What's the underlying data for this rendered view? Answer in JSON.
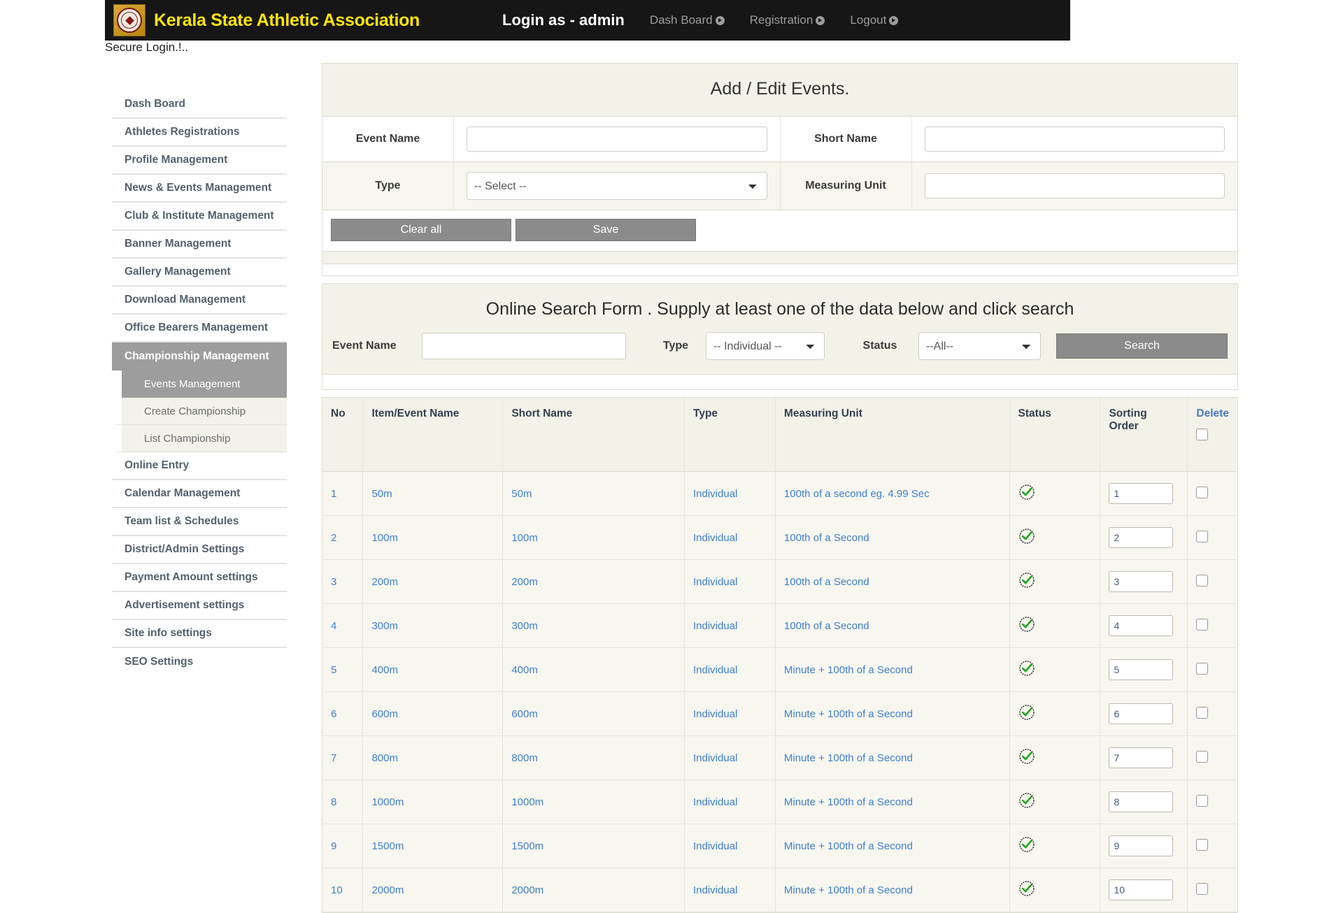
{
  "header": {
    "brand_title": "Kerala State Athletic Association",
    "logo_name": "ksaa-seal-logo",
    "login_as": "Login as - admin",
    "nav": [
      {
        "label": "Dash Board",
        "icon": "arrow-circle-icon"
      },
      {
        "label": "Registration",
        "icon": "arrow-circle-icon"
      },
      {
        "label": "Logout",
        "icon": "arrow-circle-icon"
      }
    ]
  },
  "secure_login_text": "Secure Login.!..",
  "sidebar": {
    "items": [
      {
        "label": "Dash Board",
        "active": false
      },
      {
        "label": "Athletes Registrations",
        "active": false
      },
      {
        "label": "Profile Management",
        "active": false
      },
      {
        "label": "News & Events Management",
        "active": false
      },
      {
        "label": "Club & Institute Management",
        "active": false
      },
      {
        "label": "Banner Management",
        "active": false
      },
      {
        "label": "Gallery Management",
        "active": false
      },
      {
        "label": "Download Management",
        "active": false
      },
      {
        "label": "Office Bearers Management",
        "active": false
      },
      {
        "label": "Championship Management",
        "active": true
      }
    ],
    "sub_items": [
      {
        "label": "Events Management",
        "active": true
      },
      {
        "label": "Create Championship",
        "active": false
      },
      {
        "label": "List Championship",
        "active": false
      }
    ],
    "items_after": [
      {
        "label": "Online Entry"
      },
      {
        "label": "Calendar Management"
      },
      {
        "label": "Team list & Schedules"
      },
      {
        "label": "District/Admin Settings"
      },
      {
        "label": "Payment Amount settings"
      },
      {
        "label": "Advertisement settings"
      },
      {
        "label": "Site info settings"
      },
      {
        "label": "SEO Settings"
      }
    ]
  },
  "add_edit_panel": {
    "title": "Add / Edit Events.",
    "fields": {
      "event_name_label": "Event Name",
      "event_name_value": "",
      "short_name_label": "Short Name",
      "short_name_value": "",
      "type_label": "Type",
      "type_value": "-- Select --",
      "measuring_unit_label": "Measuring Unit",
      "measuring_unit_value": ""
    },
    "buttons": {
      "clear_all": "Clear all",
      "save": "Save"
    }
  },
  "search_panel": {
    "title": "Online Search Form . Supply at least one of the data below and click search",
    "event_name_label": "Event Name",
    "event_name_value": "",
    "type_label": "Type",
    "type_value": "-- Individual --",
    "status_label": "Status",
    "status_value": "--All--",
    "search_button": "Search"
  },
  "table": {
    "headers": [
      "No",
      "Item/Event Name",
      "Short Name",
      "Type",
      "Measuring Unit",
      "Status",
      "Sorting Order",
      "Delete"
    ],
    "header_delete_checkbox": false,
    "rows": [
      {
        "no": "1",
        "item": "50m",
        "short": "50m",
        "type": "Individual",
        "unit": "100th of a second eg. 4.99 Sec",
        "status": "active",
        "sort": "1",
        "delete": false
      },
      {
        "no": "2",
        "item": "100m",
        "short": "100m",
        "type": "Individual",
        "unit": "100th of a Second",
        "status": "active",
        "sort": "2",
        "delete": false
      },
      {
        "no": "3",
        "item": "200m",
        "short": "200m",
        "type": "Individual",
        "unit": "100th of a Second",
        "status": "active",
        "sort": "3",
        "delete": false
      },
      {
        "no": "4",
        "item": "300m",
        "short": "300m",
        "type": "Individual",
        "unit": "100th of a Second",
        "status": "active",
        "sort": "4",
        "delete": false
      },
      {
        "no": "5",
        "item": "400m",
        "short": "400m",
        "type": "Individual",
        "unit": "Minute + 100th of a Second",
        "status": "active",
        "sort": "5",
        "delete": false
      },
      {
        "no": "6",
        "item": "600m",
        "short": "600m",
        "type": "Individual",
        "unit": "Minute + 100th of a Second",
        "status": "active",
        "sort": "6",
        "delete": false
      },
      {
        "no": "7",
        "item": "800m",
        "short": "800m",
        "type": "Individual",
        "unit": "Minute + 100th of a Second",
        "status": "active",
        "sort": "7",
        "delete": false
      },
      {
        "no": "8",
        "item": "1000m",
        "short": "1000m",
        "type": "Individual",
        "unit": "Minute + 100th of a Second",
        "status": "active",
        "sort": "8",
        "delete": false
      },
      {
        "no": "9",
        "item": "1500m",
        "short": "1500m",
        "type": "Individual",
        "unit": "Minute + 100th of a Second",
        "status": "active",
        "sort": "9",
        "delete": false
      },
      {
        "no": "10",
        "item": "2000m",
        "short": "2000m",
        "type": "Individual",
        "unit": "Minute + 100th of a Second",
        "status": "active",
        "sort": "10",
        "delete": false
      }
    ]
  },
  "colors": {
    "brand_yellow": "#ffe500",
    "topbar_black": "#161616",
    "link_blue": "#3f7fcf",
    "status_green": "#22aa22",
    "panel_cream": "#f3f2e9",
    "button_grey": "#8b8b8b",
    "active_grey": "#9d9d9d"
  }
}
